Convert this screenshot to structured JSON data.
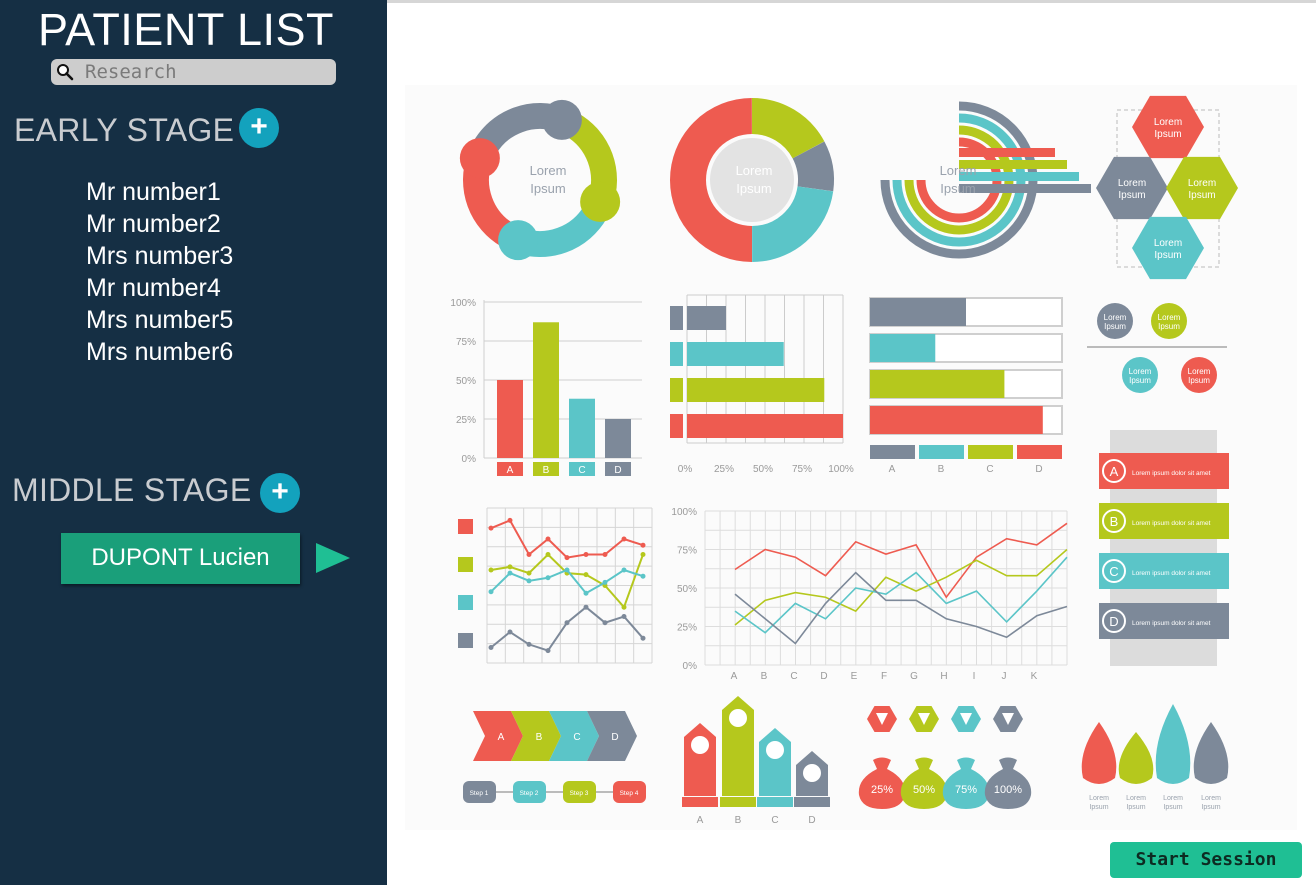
{
  "sidebar": {
    "title": "PATIENT LIST",
    "search": {
      "placeholder": "Research",
      "value": ""
    },
    "early_stage": {
      "label": "EARLY STAGE",
      "add_icon": "plus-icon",
      "patients": [
        "Mr number1",
        "Mr number2",
        "Mrs number3",
        "Mr number4",
        "Mrs number5",
        "Mrs number6"
      ]
    },
    "middle_stage": {
      "label": "MIDDLE STAGE",
      "add_icon": "plus-icon",
      "patients": [
        "DUPONT Lucien"
      ],
      "selected_icon": "play-arrow-icon"
    }
  },
  "main": {
    "start_button": "Start Session",
    "infographic": {
      "placeholder_text": "Lorem Ipsum",
      "legend_text": "Lorem ipsum dolor sit amet",
      "percent_ticks": [
        "0%",
        "25%",
        "50%",
        "75%",
        "100%"
      ],
      "letters_abcd": [
        "A",
        "B",
        "C",
        "D"
      ],
      "letters_line": [
        "A",
        "B",
        "C",
        "D",
        "E",
        "F",
        "G",
        "H",
        "I",
        "J",
        "K"
      ],
      "steps": [
        "Step 1",
        "Step 2",
        "Step 3",
        "Step 4"
      ],
      "bags": [
        "25%",
        "50%",
        "75%",
        "100%"
      ],
      "bar_values": [
        50,
        87,
        38,
        25
      ],
      "hbar_values": [
        0.25,
        0.62,
        0.88,
        1.0
      ],
      "line_series": [
        [
          62,
          75,
          70,
          58,
          80,
          72,
          78,
          44,
          70,
          82,
          78,
          92
        ],
        [
          26,
          42,
          47,
          44,
          35,
          57,
          48,
          57,
          68,
          58,
          58,
          75
        ],
        [
          35,
          21,
          40,
          30,
          50,
          46,
          60,
          40,
          48,
          28,
          48,
          70
        ],
        [
          46,
          30,
          14,
          40,
          60,
          42,
          42,
          30,
          25,
          18,
          32,
          38
        ]
      ]
    }
  },
  "colors": {
    "sidebar_bg": "#152f44",
    "accent_blue": "#13a2bd",
    "patient_green": "#1a9f7a",
    "start_green": "#1fbf94",
    "info_red": "#ee5b50",
    "info_green": "#b5c81d",
    "info_teal": "#5bc5c8",
    "info_gray": "#7d8999"
  }
}
